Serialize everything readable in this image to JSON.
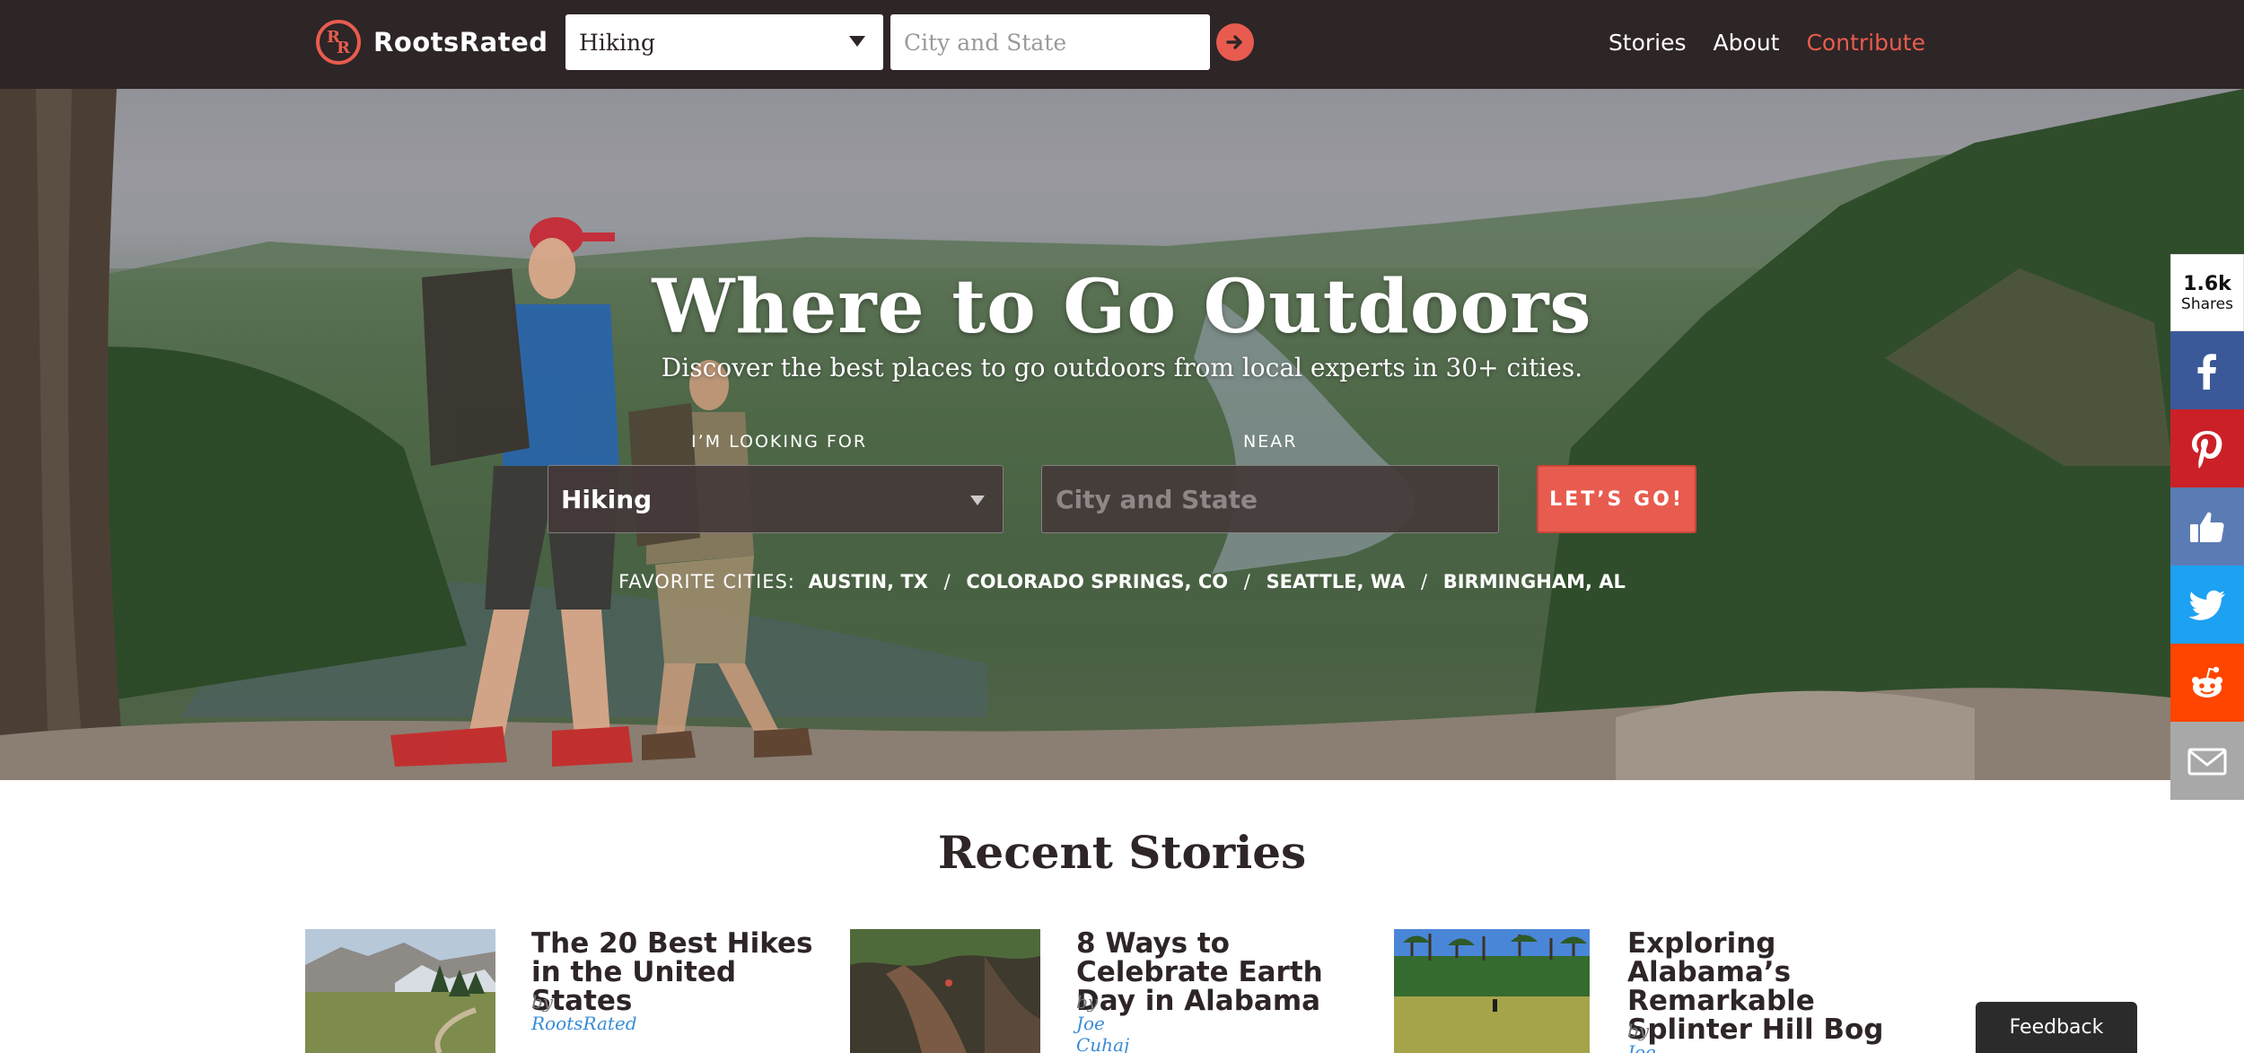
{
  "brand": {
    "name": "RootsRated",
    "logo_letters": [
      "R",
      "R"
    ]
  },
  "topnav": {
    "activity_value": "Hiking",
    "location_placeholder": "City and State",
    "go_icon": "arrow-right-icon",
    "links": [
      "Stories",
      "About",
      "Contribute"
    ]
  },
  "hero": {
    "title": "Where to Go Outdoors",
    "subtitle": "Discover the best places to go outdoors from local experts in 30+ cities.",
    "looking_for_label": "I’M LOOKING FOR",
    "near_label": "NEAR",
    "activity_value": "Hiking",
    "location_placeholder": "City and State",
    "go_label": "LET’S GO!",
    "favorite_label": "FAVORITE CITIES:",
    "favorite_cities": [
      "AUSTIN, TX",
      "COLORADO SPRINGS, CO",
      "SEATTLE, WA",
      "BIRMINGHAM, AL"
    ],
    "separator": "/"
  },
  "share": {
    "count": "1.6k",
    "count_label": "Shares",
    "networks": [
      {
        "name": "facebook-icon",
        "color": "#3b5998"
      },
      {
        "name": "pinterest-icon",
        "color": "#cb2027"
      },
      {
        "name": "like-icon",
        "color": "#5b7bb4"
      },
      {
        "name": "twitter-icon",
        "color": "#1da1f2"
      },
      {
        "name": "reddit-icon",
        "color": "#ff4500"
      },
      {
        "name": "email-icon",
        "color": "#a8a8a8"
      }
    ]
  },
  "recent": {
    "title": "Recent Stories",
    "stories": [
      {
        "title": "The 20 Best Hikes in the United States",
        "by": "by",
        "author": "RootsRated"
      },
      {
        "title": "8 Ways to Celebrate Earth Day in Alabama",
        "by": "by",
        "author": "Joe Cuhaj"
      },
      {
        "title": "Exploring Alabama’s Remarkable Splinter Hill Bog",
        "by": "by",
        "author": "Joe Cuhaj"
      }
    ]
  },
  "feedback_label": "Feedback",
  "colors": {
    "nav_bg": "#2e2526",
    "accent": "#e85c4f",
    "link": "#3a8cd6"
  }
}
